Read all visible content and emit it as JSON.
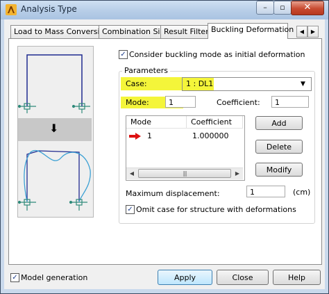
{
  "window": {
    "title": "Analysis Type",
    "minimize": "–",
    "maximize": "▫",
    "close": "✕"
  },
  "tabs": [
    {
      "label": "Load to Mass Conversion",
      "active": false
    },
    {
      "label": "Combination Sign",
      "active": false
    },
    {
      "label": "Result Filters",
      "active": false
    },
    {
      "label": "Buckling Deformation",
      "active": true
    }
  ],
  "tab_scroll": {
    "left": "◀",
    "right": "▶"
  },
  "preview": {
    "arrow": "⬇"
  },
  "buckling": {
    "consider_label": "Consider buckling mode as initial deformation",
    "consider_checked": true,
    "parameters_label": "Parameters",
    "case_label": "Case:",
    "case_value": "1 : DL1",
    "mode_label": "Mode:",
    "mode_value": "1",
    "coefficient_label": "Coefficient:",
    "coefficient_value": "1",
    "table": {
      "columns": [
        "Mode",
        "Coefficient"
      ],
      "rows": [
        {
          "mode": "1",
          "coefficient": "1.000000"
        }
      ]
    },
    "add_label": "Add",
    "delete_label": "Delete",
    "modify_label": "Modify",
    "max_disp_label": "Maximum displacement:",
    "max_disp_value": "1",
    "max_disp_unit": "(cm)",
    "omit_label": "Omit case for structure with deformations",
    "omit_checked": true
  },
  "footer": {
    "model_generation_label": "Model generation",
    "model_generation_checked": true,
    "apply_label": "Apply",
    "close_label": "Close",
    "help_label": "Help"
  },
  "colors": {
    "highlight": "#f4f53a",
    "structure": "#1f2a8f",
    "deformed": "#3aa0d4",
    "support": "#2f8a7a",
    "row_arrow": "#d11"
  }
}
